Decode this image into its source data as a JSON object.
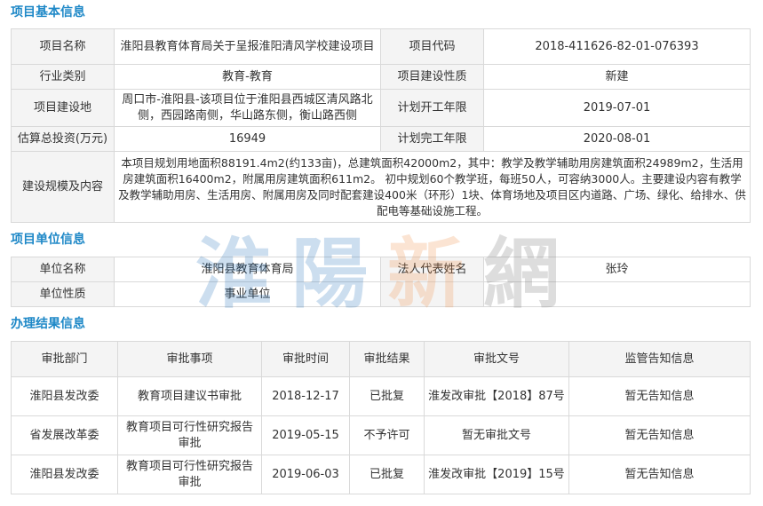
{
  "basic": {
    "title": "项目基本信息",
    "project_name_label": "项目名称",
    "project_name": "淮阳县教育体育局关于呈报淮阳清风学校建设项目",
    "project_code_label": "项目代码",
    "project_code": "2018-411626-82-01-076393",
    "industry_label": "行业类别",
    "industry": "教育-教育",
    "nature_label": "项目建设性质",
    "nature": "新建",
    "location_label": "项目建设地",
    "location": "周口市-淮阳县-该项目位于淮阳县西城区清风路北侧，西园路南侧，华山路东侧，衡山路西侧",
    "start_label": "计划开工年限",
    "start": "2019-07-01",
    "investment_label": "估算总投资(万元)",
    "investment": "16949",
    "end_label": "计划完工年限",
    "end": "2020-08-01",
    "scale_label": "建设规模及内容",
    "scale": "本项目规划用地面积88191.4m2(约133亩)，总建筑面积42000m2，其中：教学及教学辅助用房建筑面积24989m2，生活用房建筑面积16400m2，附属用房建筑面积611m2。 初中规划60个教学班，每班50人，可容纳3000人。主要建设内容有教学及教学辅助用房、生活用房、附属用房及同时配套建设400米（环形）1块、体育场地及项目区内道路、广场、绿化、给排水、供配电等基础设施工程。"
  },
  "unit": {
    "title": "项目单位信息",
    "name_label": "单位名称",
    "name": "淮阳县教育体育局",
    "rep_label": "法人代表姓名",
    "rep": "张玲",
    "type_label": "单位性质",
    "type": "事业单位"
  },
  "results": {
    "title": "办理结果信息",
    "headers": [
      "审批部门",
      "审批事项",
      "审批时间",
      "审批结果",
      "审批文号",
      "监管告知信息"
    ],
    "rows": [
      [
        "淮阳县发改委",
        "教育项目建议书审批",
        "2018-12-17",
        "已批复",
        "淮发改审批【2018】87号",
        "暂无告知信息"
      ],
      [
        "省发展改革委",
        "教育项目可行性研究报告审批",
        "2019-05-15",
        "不予许可",
        "暂无审批文号",
        "暂无告知信息"
      ],
      [
        "淮阳县发改委",
        "教育项目可行性研究报告审批",
        "2019-06-03",
        "已批复",
        "淮发改审批【2019】15号",
        "暂无告知信息"
      ]
    ]
  },
  "watermark": {
    "chars": [
      "淮",
      "陽",
      "新",
      "網"
    ],
    "colors": [
      "#1e6fb8",
      "#1e6fb8",
      "#f08a3c",
      "#6a6a6a"
    ]
  }
}
